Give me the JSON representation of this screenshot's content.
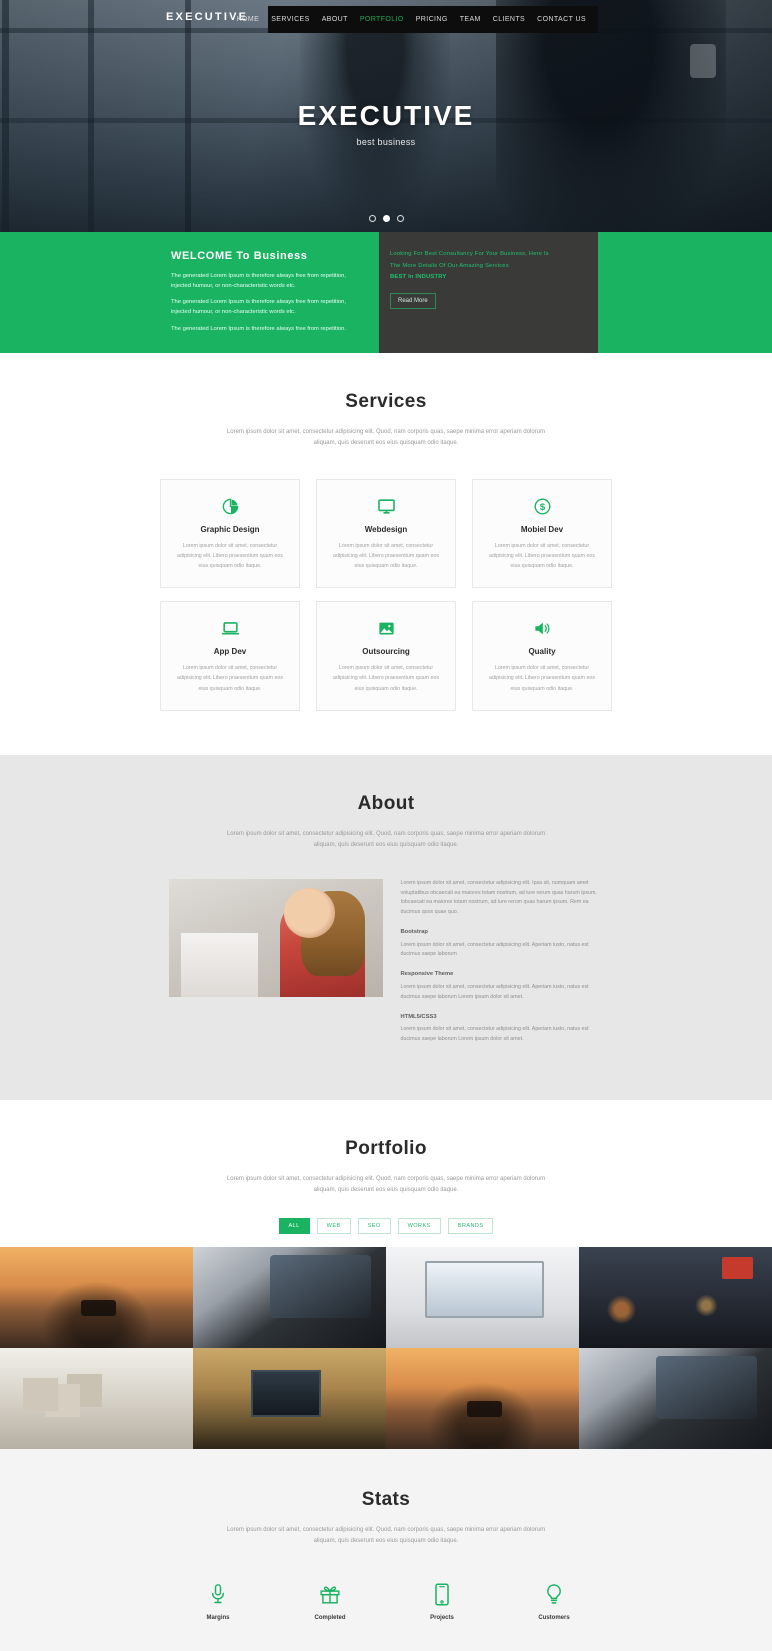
{
  "nav": {
    "logo": "EXECUTIVE",
    "items": [
      {
        "label": "HOME",
        "active": false
      },
      {
        "label": "SERVICES",
        "active": false
      },
      {
        "label": "ABOUT",
        "active": false
      },
      {
        "label": "PORTFOLIO",
        "active": true
      },
      {
        "label": "PRICING",
        "active": false
      },
      {
        "label": "TEAM",
        "active": false
      },
      {
        "label": "CLIENTS",
        "active": false
      },
      {
        "label": "CONTACT US",
        "active": false
      }
    ],
    "accent_color": "#18a85b"
  },
  "hero": {
    "title": "EXECUTIVE",
    "subtitle": "best business",
    "slide_count": 3,
    "active_slide": 2
  },
  "welcome": {
    "title": "WELCOME To Business",
    "paragraphs": [
      "The generated Lorem Ipsum is therefore always free from repetition, injected humour, or non-characteristic words etc.",
      "The generated Lorem Ipsum is therefore always free from repetition, injected humour, or non-characteristic words etc.",
      "The generated Lorem Ipsum is therefore always free from repetition."
    ],
    "panel": {
      "line1": "Looking For Best Consultancy For Your Business, Here Is",
      "line2": "The More Details Of Our Amazing Services",
      "line3": "BEST In INDUSTRY",
      "button": "Read More"
    },
    "bg_color": "#19b361",
    "panel_color": "#3a3a38"
  },
  "services": {
    "title": "Services",
    "description": "Lorem ipsum dolor sit amet, consectetur adipisicing elit. Quod, nam corporis quas, saepe minima error aperiam dolorum aliquam, quis deserunt eos eius quisquam odio itaque.",
    "cards": [
      {
        "icon": "pie-chart-icon",
        "title": "Graphic Design",
        "text": "Lorem ipsum dolor sit amet, consectetur adipisicing elit. Libero praesentium quam eos eius quisquam odio itaque."
      },
      {
        "icon": "monitor-icon",
        "title": "Webdesign",
        "text": "Lorem ipsum dolor sit amet, consectetur adipisicing elit. Libero praesentium quam eos eius quisquam odio itaque."
      },
      {
        "icon": "dollar-icon",
        "title": "Mobiel Dev",
        "text": "Lorem ipsum dolor sit amet, consectetur adipisicing elit. Libero praesentium quam eos eius quisquam odio itaque."
      },
      {
        "icon": "laptop-icon",
        "title": "App Dev",
        "text": "Lorem ipsum dolor sit amet, consectetur adipisicing elit. Libero praesentium quam eos eius quisquam odio itaque."
      },
      {
        "icon": "image-icon",
        "title": "Outsourcing",
        "text": "Lorem ipsum dolor sit amet, consectetur adipisicing elit. Libero praesentium quam eos eius quisquam odio itaque."
      },
      {
        "icon": "speaker-icon",
        "title": "Quality",
        "text": "Lorem ipsum dolor sit amet, consectetur adipisicing elit. Libero praesentium quam eos eius quisquam odio itaque."
      }
    ]
  },
  "about": {
    "title": "About",
    "description": "Lorem ipsum dolor sit amet, consectetur adipisicing elit. Quod, nam corporis quas, saepe minima error aperiam dolorum aliquam, quis deserunt eos eius quisquam odio itaque.",
    "lead": "Lorem ipsum dolor sit amet, consectetur adipisicing elit. Ipsa sit, numquam amet voluptatibus obcaecati ea maiores totam nostrum, ad iure rerum quas harum ipsum. Iobcaecati ea maiores totam nostrum, ad iure rerum quas harum ipsum. Rem ea ducimus quos quae quo.",
    "blocks": [
      {
        "heading": "Bootstrap",
        "text": "Lorem ipsum dolor sit amet, consectetur adipisicing elit. Aperiam iusto, natus est ducimus saepe laborum"
      },
      {
        "heading": "Responsive Theme",
        "text": "Lorem ipsum dolor sit amet, consectetur adipisicing elit. Aperiam iusto, natus est ducimus saepe laborum Lorem ipsum dolor sit amet."
      },
      {
        "heading": "HTML5/CSS3",
        "text": "Lorem ipsum dolor sit amet, consectetur adipisicing elit. Aperiam iusto, natus est ducimus saepe laborum Lorem ipsum dolor sit amet."
      }
    ]
  },
  "portfolio": {
    "title": "Portfolio",
    "description": "Lorem ipsum dolor sit amet, consectetur adipisicing elit. Quod, nam corporis quas, saepe minima error aperiam dolorum aliquam, quis deserunt eos eius quisquam odio itaque.",
    "filters": [
      {
        "label": "ALL",
        "active": true
      },
      {
        "label": "WEB",
        "active": false
      },
      {
        "label": "SEO",
        "active": false
      },
      {
        "label": "WORKS",
        "active": false
      },
      {
        "label": "BRANDS",
        "active": false
      }
    ],
    "tiles": [
      {
        "name": "drone-sunset-thumbnail",
        "style": "t-drone"
      },
      {
        "name": "tablet-laptop-thumbnail",
        "style": "t-tablet"
      },
      {
        "name": "imac-desktop-thumbnail",
        "style": "t-imac"
      },
      {
        "name": "night-street-thumbnail",
        "style": "t-street"
      },
      {
        "name": "wooden-cubes-thumbnail",
        "style": "t-cubes"
      },
      {
        "name": "office-desk-thumbnail",
        "style": "t-desk"
      },
      {
        "name": "drone-sunset-thumbnail-2",
        "style": "t-drone"
      },
      {
        "name": "tablet-laptop-thumbnail-2",
        "style": "t-tablet"
      }
    ]
  },
  "stats": {
    "title": "Stats",
    "description": "Lorem ipsum dolor sit amet, consectetur adipisicing elit. Quod, nam corporis quas, saepe minima error aperiam dolorum aliquam, quis deserunt eos eius quisquam odio itaque.",
    "items": [
      {
        "icon": "microphone-icon",
        "label": "Margins"
      },
      {
        "icon": "gift-icon",
        "label": "Completed"
      },
      {
        "icon": "mobile-phone-icon",
        "label": "Projects"
      },
      {
        "icon": "lightbulb-icon",
        "label": "Customers"
      }
    ]
  },
  "theme": {
    "green": "#19b361",
    "dark": "#0d0d0d",
    "panel": "#3a3a38",
    "about_bg": "#e7e7e7",
    "stats_bg": "#f4f4f4"
  }
}
